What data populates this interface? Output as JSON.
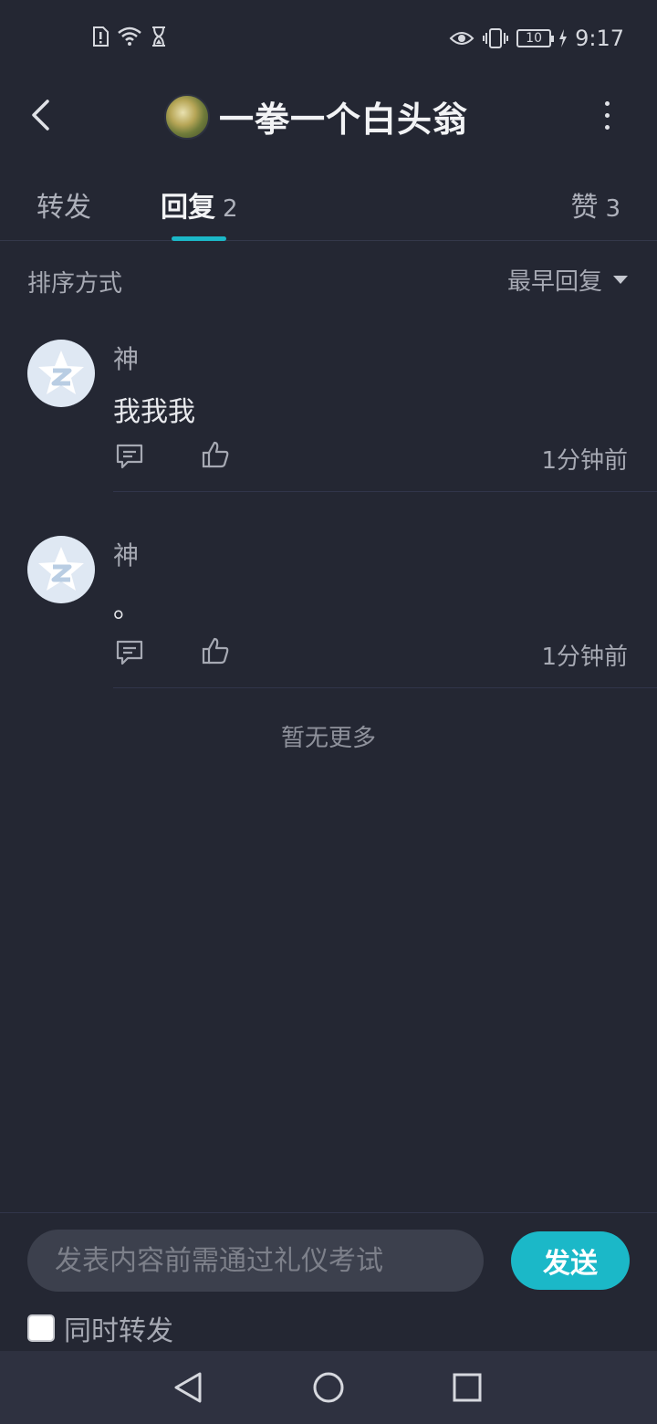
{
  "status_bar": {
    "time": "9:17",
    "battery": "10",
    "icons_left": [
      "sim-alert-icon",
      "wifi-icon",
      "hourglass-icon"
    ],
    "icons_right": [
      "eye-icon",
      "vibrate-icon",
      "battery-icon",
      "charging-icon"
    ]
  },
  "header": {
    "title": "一拳一个白头翁",
    "back_icon": "chevron-left-icon",
    "more_icon": "more-vertical-icon"
  },
  "tabs": {
    "forward": {
      "label": "转发",
      "count": ""
    },
    "reply": {
      "label": "回复",
      "count": "2"
    },
    "like": {
      "label": "赞",
      "count": "3"
    },
    "active": "reply",
    "accent_color": "#1bb8c8"
  },
  "sort": {
    "label": "排序方式",
    "selected": "最早回复"
  },
  "replies": [
    {
      "name": "神",
      "text": "我我我",
      "time": "1分钟前"
    },
    {
      "name": "神",
      "text": "。",
      "time": "1分钟前"
    }
  ],
  "no_more": "暂无更多",
  "composer": {
    "placeholder": "发表内容前需通过礼仪考试",
    "send_label": "发送",
    "also_forward_label": "同时转发",
    "also_forward_checked": false
  },
  "nav": {
    "back_icon": "triangle-back-icon",
    "home_icon": "circle-home-icon",
    "recents_icon": "square-recents-icon"
  }
}
